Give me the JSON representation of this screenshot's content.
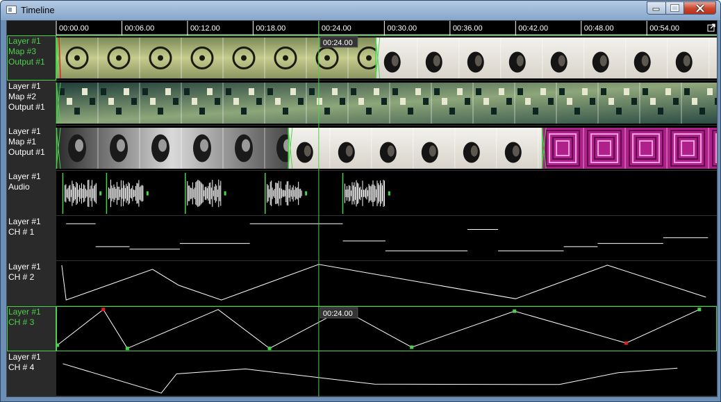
{
  "window": {
    "title": "Timeline",
    "icon": "timeline-window-icon"
  },
  "ruler": {
    "ticks": [
      "00:00.00",
      "00:06.00",
      "00:12.00",
      "00:18.00",
      "00:24.00",
      "00:30.00",
      "00:36.00",
      "00:42.00",
      "00:48.00",
      "00:54.00"
    ],
    "tick_seconds": [
      0,
      6,
      12,
      18,
      24,
      30,
      36,
      42,
      48,
      54
    ],
    "seconds_visible": 60.4,
    "expand_icon": "expand-icon"
  },
  "playhead": {
    "time": "00:24.00",
    "seconds": 24,
    "color": "#4bd24b"
  },
  "colors": {
    "active": "#4bd24b",
    "inactive": "#ffffff",
    "keyframe_red": "#e02020",
    "header_bg": "#2a2a2a"
  },
  "tracks": [
    {
      "lines": [
        "Layer #1",
        "Map #3",
        "Output #1"
      ],
      "selected": true,
      "type": "video",
      "clips": [
        {
          "start": 0,
          "end": 29.2,
          "style": "target"
        },
        {
          "start": 29.2,
          "end": 60.4,
          "style": "speaker"
        }
      ]
    },
    {
      "lines": [
        "Layer #1",
        "Map #2",
        "Output #1"
      ],
      "selected": false,
      "type": "video",
      "clips": [
        {
          "start": 0,
          "end": 60.4,
          "style": "circuit"
        }
      ]
    },
    {
      "lines": [
        "Layer #1",
        "Map #1",
        "Output #1"
      ],
      "selected": false,
      "type": "video",
      "clips": [
        {
          "start": 0,
          "end": 21.2,
          "style": "face"
        },
        {
          "start": 21.2,
          "end": 44.4,
          "style": "speaker"
        },
        {
          "start": 44.4,
          "end": 60.4,
          "style": "squares"
        }
      ]
    },
    {
      "lines": [
        "Layer #1",
        "Audio"
      ],
      "selected": false,
      "type": "audio",
      "clips": [
        {
          "start": 0.6,
          "end": 4.2
        },
        {
          "start": 4.6,
          "end": 8.5
        },
        {
          "start": 11.8,
          "end": 15.6
        },
        {
          "start": 19.1,
          "end": 23.0
        },
        {
          "start": 26.2,
          "end": 30.6
        }
      ]
    },
    {
      "lines": [
        "Layer #1",
        "CH # 1"
      ],
      "selected": false,
      "type": "steps",
      "segments": [
        [
          0.9,
          3.6,
          0.86
        ],
        [
          3.6,
          6.7,
          0.3
        ],
        [
          6.7,
          11.3,
          0.24
        ],
        [
          11.3,
          17.7,
          0.38
        ],
        [
          17.7,
          26.2,
          0.86
        ],
        [
          26.2,
          30.1,
          0.44
        ],
        [
          30.1,
          37.6,
          0.2
        ],
        [
          37.6,
          40.4,
          0.72
        ],
        [
          40.4,
          46.4,
          0.2
        ],
        [
          46.4,
          49.5,
          0.3
        ],
        [
          49.5,
          55.5,
          0.38
        ],
        [
          55.5,
          59.6,
          0.52
        ]
      ]
    },
    {
      "lines": [
        "Layer #1",
        "CH # 2"
      ],
      "selected": false,
      "type": "curve",
      "points": [
        [
          0.5,
          0.95
        ],
        [
          0.9,
          0.1
        ],
        [
          8.8,
          0.85
        ],
        [
          11.2,
          0.46
        ],
        [
          15.1,
          0.1
        ],
        [
          24.0,
          0.97
        ],
        [
          42.0,
          0.13
        ],
        [
          50.4,
          0.95
        ],
        [
          59.4,
          0.17
        ]
      ]
    },
    {
      "lines": [
        "Layer #1",
        "CH # 3"
      ],
      "selected": true,
      "type": "curve",
      "points": [
        [
          0.1,
          0.1
        ],
        [
          4.3,
          0.97
        ],
        [
          6.5,
          0.02
        ],
        [
          14.8,
          0.97
        ],
        [
          19.5,
          0.02
        ],
        [
          26.2,
          0.97
        ],
        [
          32.5,
          0.05
        ],
        [
          41.9,
          0.93
        ],
        [
          52.1,
          0.15
        ],
        [
          58.8,
          0.97
        ]
      ],
      "keys": [
        [
          0.1,
          0.1,
          "g"
        ],
        [
          4.3,
          0.97,
          "r"
        ],
        [
          6.5,
          0.02,
          "g"
        ],
        [
          19.5,
          0.02,
          "g"
        ],
        [
          32.5,
          0.05,
          "g"
        ],
        [
          41.9,
          0.93,
          "g"
        ],
        [
          52.1,
          0.15,
          "r"
        ],
        [
          58.8,
          0.97,
          "g"
        ]
      ]
    },
    {
      "lines": [
        "Layer #1",
        "CH # 4"
      ],
      "selected": false,
      "type": "curve",
      "points": [
        [
          0.6,
          0.75
        ],
        [
          9.6,
          0.03
        ],
        [
          11.0,
          0.5
        ],
        [
          17.3,
          0.62
        ],
        [
          29.1,
          0.25
        ],
        [
          46.0,
          0.24
        ],
        [
          51.4,
          0.53
        ],
        [
          56.8,
          0.64
        ]
      ]
    }
  ]
}
